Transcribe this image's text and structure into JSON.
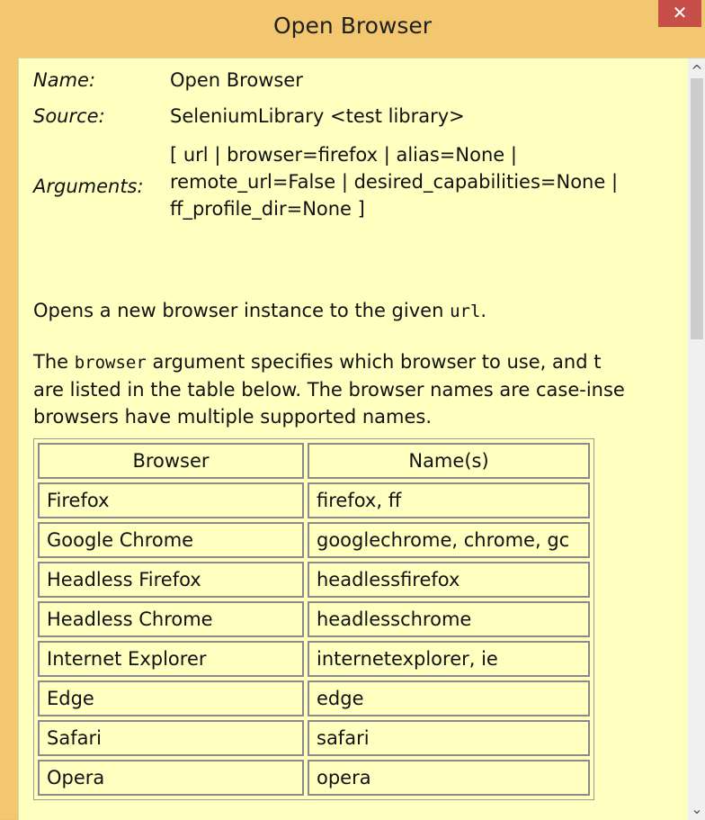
{
  "window": {
    "title": "Open Browser",
    "close_glyph": "✕"
  },
  "meta": {
    "name_label": "Name:",
    "name_value": "Open Browser",
    "source_label": "Source:",
    "source_value": "SeleniumLibrary <test library>",
    "arguments_label": "Arguments:",
    "arguments_value": "[ url | browser=firefox | alias=None | remote_url=False | desired_capabilities=None | ff_profile_dir=None ]"
  },
  "description": {
    "p1_before": "Opens a new browser instance to the given ",
    "p1_code": "url",
    "p1_after": ".",
    "p2_line1_before": "The ",
    "p2_code": "browser",
    "p2_line1_after": " argument specifies which browser to use, and t",
    "p2_line2": "are listed in the table below. The browser names are case-inse",
    "p2_line3": "browsers have multiple supported names."
  },
  "table": {
    "headers": [
      "Browser",
      "Name(s)"
    ],
    "rows": [
      [
        "Firefox",
        "firefox, ff"
      ],
      [
        "Google Chrome",
        "googlechrome, chrome, gc"
      ],
      [
        "Headless Firefox",
        "headlessfirefox"
      ],
      [
        "Headless Chrome",
        "headlesschrome"
      ],
      [
        "Internet Explorer",
        "internetexplorer, ie"
      ],
      [
        "Edge",
        "edge"
      ],
      [
        "Safari",
        "safari"
      ],
      [
        "Opera",
        "opera"
      ]
    ]
  },
  "scrollbar": {
    "up_glyph": "^",
    "down_glyph": "⌄"
  }
}
